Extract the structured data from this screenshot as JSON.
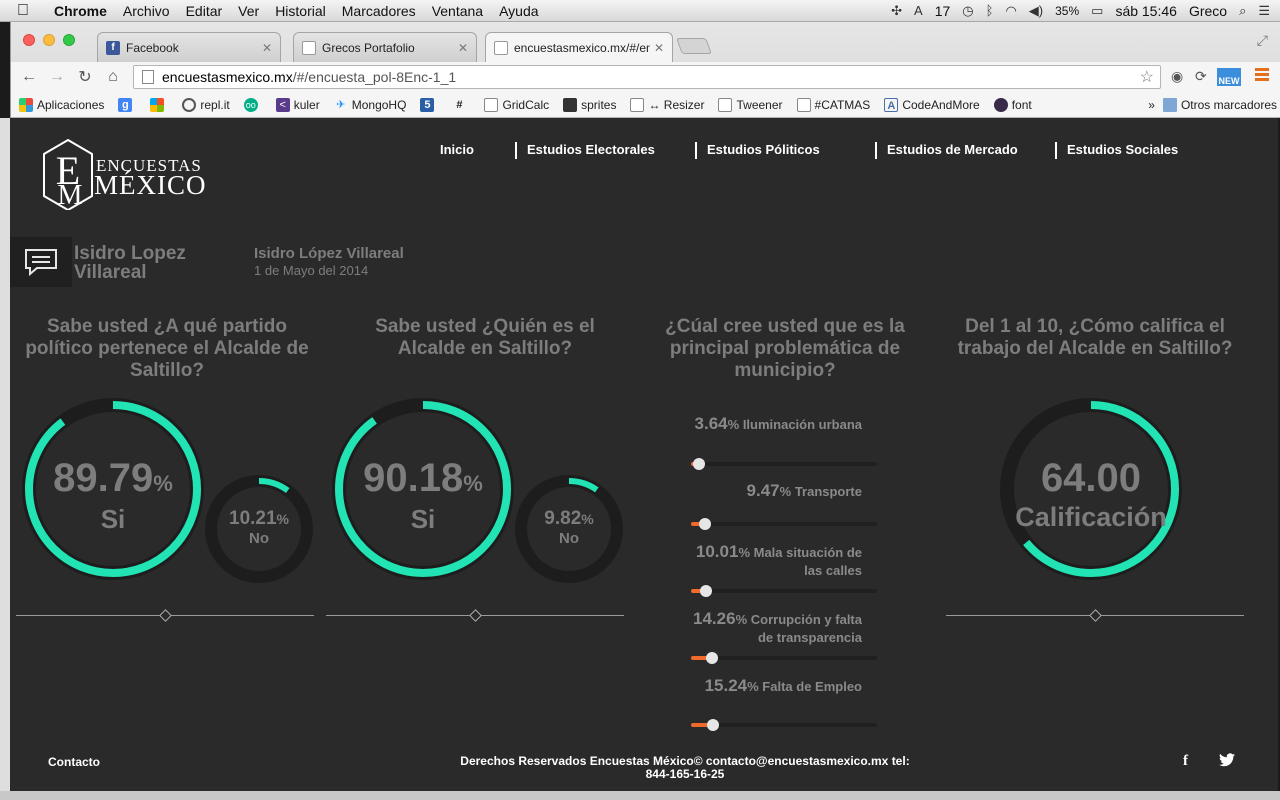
{
  "menubar": {
    "app": "Chrome",
    "items": [
      "Archivo",
      "Editar",
      "Ver",
      "Historial",
      "Marcadores",
      "Ventana",
      "Ayuda"
    ],
    "tray_count": "17",
    "battery": "35%",
    "clock": "sáb 15:46",
    "user": "Greco"
  },
  "browser": {
    "tabs": [
      {
        "title": "Facebook",
        "icon": "facebook-icon"
      },
      {
        "title": "Grecos Portafolio",
        "icon": "page-icon"
      },
      {
        "title": "encuestasmexico.mx/#/en",
        "icon": "page-icon"
      }
    ],
    "url_host": "encuestasmexico.mx",
    "url_path": "/#/encuesta_pol-8Enc-1_1",
    "new_badge": "NEW",
    "bookmarks": [
      {
        "label": "Aplicaciones",
        "icon": "apps-grid-icon"
      },
      {
        "label": "",
        "icon": "google-plus-icon"
      },
      {
        "label": "",
        "icon": "windows-icon"
      },
      {
        "label": "repl.it",
        "icon": "replit-icon"
      },
      {
        "label": "",
        "icon": "tripadvisor-icon"
      },
      {
        "label": "kuler",
        "icon": "kuler-icon"
      },
      {
        "label": "MongoHQ",
        "icon": "mongo-icon"
      },
      {
        "label": "",
        "icon": "html5-icon"
      },
      {
        "label": "",
        "icon": "hash-icon"
      },
      {
        "label": "GridCalc",
        "icon": "page-icon"
      },
      {
        "label": "sprites",
        "icon": "sprites-icon"
      },
      {
        "label": "↔ Resizer",
        "icon": "page-icon"
      },
      {
        "label": "Tweener",
        "icon": "page-icon"
      },
      {
        "label": "#CATMAS",
        "icon": "page-icon"
      },
      {
        "label": "CodeAndMore",
        "icon": "codeandmore-icon"
      },
      {
        "label": "font",
        "icon": "font-icon"
      }
    ],
    "other_bookmarks": "Otros marcadores",
    "more": "»"
  },
  "site": {
    "logo": {
      "line1": "ENCUESTAS",
      "line2": "MÉXICO"
    },
    "nav": [
      "Inicio",
      "Estudios Electorales",
      "Estudios Póliticos",
      "Estudios de Mercado",
      "Estudios Sociales"
    ],
    "profile": {
      "short_name": "Isidro Lopez Villareal",
      "full_name": "Isidro López Villareal",
      "date": "1 de Mayo del 2014"
    },
    "questions": [
      "Sabe usted ¿A qué partido político pertenece el Alcalde de Saltillo?",
      "Sabe usted ¿Quién es el Alcalde en Saltillo?",
      "¿Cúal cree usted que es la principal problemática de municipio?",
      "Del 1 al 10, ¿Cómo califica el trabajo del Alcalde en Saltillo?"
    ],
    "q1": {
      "main": {
        "value": "89.79",
        "unit": "%",
        "label": "Si",
        "fraction": 0.8979
      },
      "minor": {
        "value": "10.21",
        "unit": "%",
        "label": "No",
        "fraction": 0.1021
      }
    },
    "q2": {
      "main": {
        "value": "90.18",
        "unit": "%",
        "label": "Si",
        "fraction": 0.9018
      },
      "minor": {
        "value": "9.82",
        "unit": "%",
        "label": "No",
        "fraction": 0.0982
      }
    },
    "q3": [
      {
        "value": "3.64",
        "unit": "%",
        "label": "Iluminación urbana",
        "fraction": 0.0364
      },
      {
        "value": "9.47",
        "unit": "%",
        "label": "Transporte",
        "fraction": 0.0947
      },
      {
        "value": "10.01",
        "unit": "%",
        "label": "Mala situación de las calles",
        "fraction": 0.1001
      },
      {
        "value": "14.26",
        "unit": "%",
        "label": "Corrupción y falta de transparencia",
        "fraction": 0.1426
      },
      {
        "value": "15.24",
        "unit": "%",
        "label": "Falta de Empleo",
        "fraction": 0.1524
      }
    ],
    "q4": {
      "value": "64.00",
      "label": "Calificación",
      "fraction": 0.64
    },
    "footer": {
      "contact": "Contacto",
      "rights": "Derechos Reservados Encuestas México© contacto@encuestasmexico.mx tel: 844-165-16-25",
      "facebook": "f",
      "twitter": "twitter-icon"
    }
  },
  "colors": {
    "ring_accent": "#22e3b4",
    "ring_track": "#1d1d1d",
    "slider_fill": "#f06a2c",
    "bg": "#2b2a2b"
  }
}
